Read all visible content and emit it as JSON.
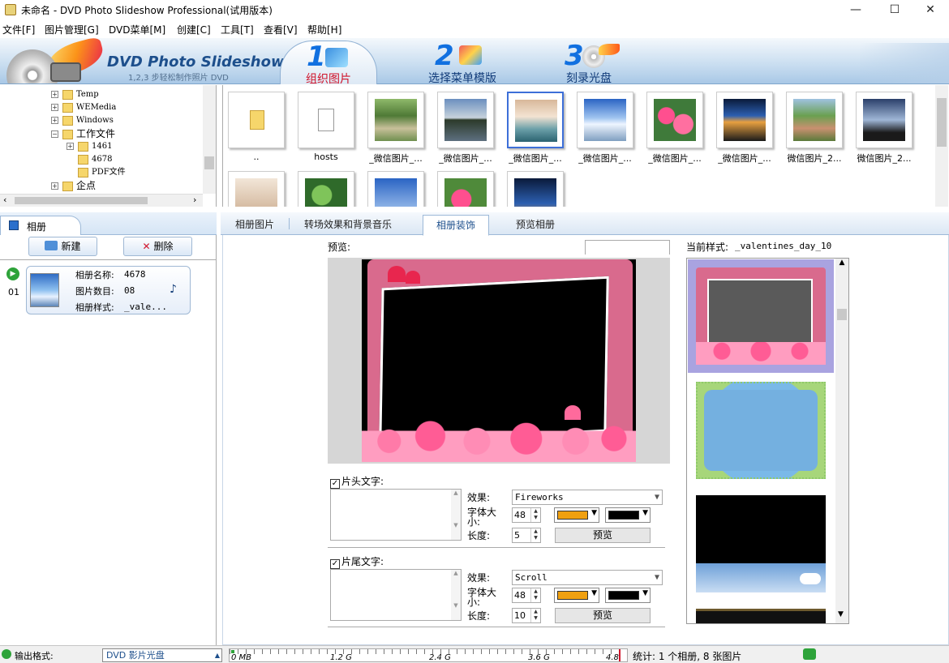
{
  "window": {
    "title": "未命名 - DVD Photo Slideshow Professional(试用版本)",
    "minimize": "—",
    "maximize": "☐",
    "close": "✕"
  },
  "menu": [
    "文件[F]",
    "图片管理[G]",
    "DVD菜单[M]",
    "创建[C]",
    "工具[T]",
    "查看[V]",
    "帮助[H]"
  ],
  "banner": {
    "app_title": "DVD Photo Slideshow",
    "app_subtitle": "1,2,3 步轻松制作照片 DVD",
    "steps": [
      {
        "num": "1",
        "label": "组织图片",
        "active": true
      },
      {
        "num": "2",
        "label": "选择菜单模版",
        "active": false
      },
      {
        "num": "3",
        "label": "刻录光盘",
        "active": false
      }
    ]
  },
  "tree": {
    "items": [
      {
        "label": "Temp"
      },
      {
        "label": "WEMedia"
      },
      {
        "label": "Windows"
      },
      {
        "label": "工作文件"
      },
      {
        "label": "1461"
      },
      {
        "label": "4678"
      },
      {
        "label": "PDF文件"
      },
      {
        "label": "企点"
      }
    ]
  },
  "thumbnails": [
    {
      "caption": "..",
      "kind": "folder"
    },
    {
      "caption": "hosts",
      "kind": "file"
    },
    {
      "caption": "_微信图片_...",
      "kind": "path"
    },
    {
      "caption": "_微信图片_...",
      "kind": "lake"
    },
    {
      "caption": "_微信图片_...",
      "kind": "cat",
      "selected": true
    },
    {
      "caption": "_微信图片_...",
      "kind": "sky"
    },
    {
      "caption": "_微信图片_...",
      "kind": "flowers"
    },
    {
      "caption": "_微信图片_...",
      "kind": "night"
    },
    {
      "caption": "微信图片_2...",
      "kind": "garden"
    },
    {
      "caption": "微信图片_2...",
      "kind": "dusk"
    },
    {
      "caption": "",
      "kind": "cat2"
    },
    {
      "caption": "",
      "kind": "leaves"
    },
    {
      "caption": "",
      "kind": "sky2"
    },
    {
      "caption": "",
      "kind": "flowers2"
    },
    {
      "caption": "",
      "kind": "night2"
    }
  ],
  "left": {
    "tab": "相册",
    "new_btn": "新建",
    "delete_btn": "删除",
    "album": {
      "index": "01",
      "name_label": "相册名称:",
      "name": "4678",
      "count_label": "图片数目:",
      "count": "08",
      "style_label": "相册样式:",
      "style": "_vale..."
    }
  },
  "tabs": [
    "相册图片",
    "转场效果和背景音乐",
    "相册装饰",
    "预览相册"
  ],
  "active_tab": 2,
  "decor": {
    "preview_label": "预览:",
    "current_style_label": "当前样式:",
    "current_style": "_valentines_day_10",
    "header_text": {
      "label": "片头文字:",
      "checked": true,
      "effect_label": "效果:",
      "effect": "Fireworks",
      "size_label": "字体大小:",
      "size": "48",
      "length_label": "长度:",
      "length": "5",
      "color1": "#f0a010",
      "color2": "#000000",
      "preview_btn": "预览"
    },
    "footer_text": {
      "label": "片尾文字:",
      "checked": true,
      "effect_label": "效果:",
      "effect": "Scroll",
      "size_label": "字体大小:",
      "size": "48",
      "length_label": "长度:",
      "length": "10",
      "color1": "#f0a010",
      "color2": "#000000",
      "preview_btn": "预览"
    }
  },
  "status": {
    "format_label": "输出格式:",
    "format": "DVD 影片光盘",
    "ticks": [
      "0 MB",
      "1.2 G",
      "2.4 G",
      "3.6 G",
      "4.8 G"
    ],
    "stats": "统计: 1 个相册, 8 张图片"
  },
  "colors": {
    "accent": "#1170e0",
    "active_step": "#d0142b",
    "selection": "#3d6fd8",
    "frame_pink": "#d96a8d"
  }
}
